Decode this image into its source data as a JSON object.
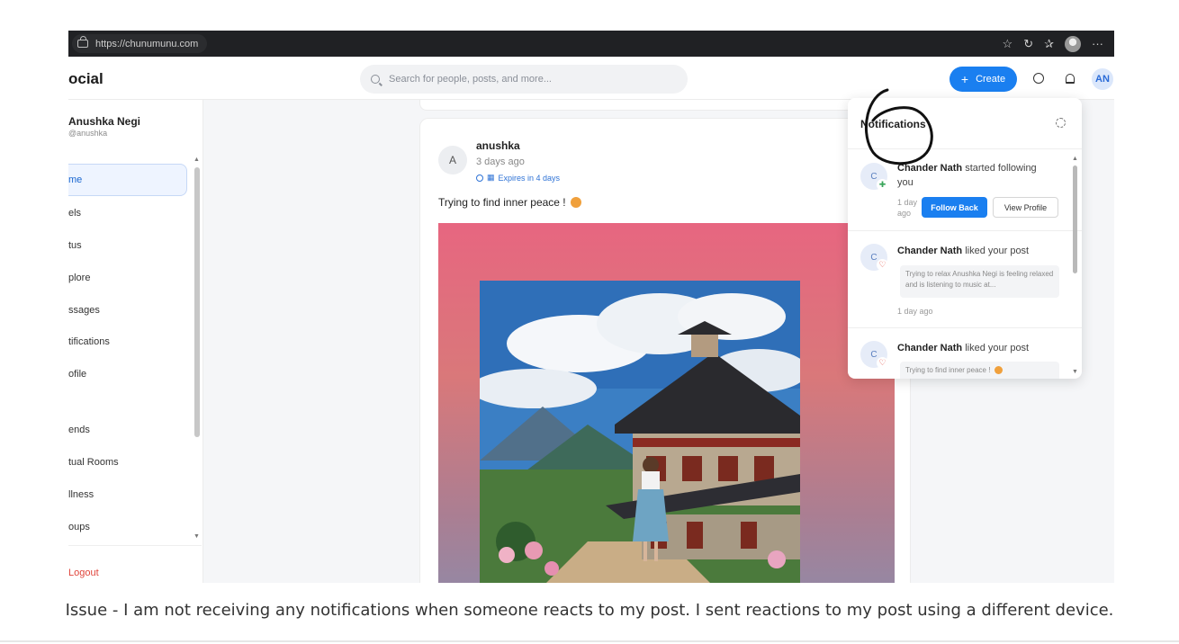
{
  "browser": {
    "url": "https://chunumunu.com",
    "icons": [
      "lock-icon",
      "star-icon",
      "refresh-icon",
      "favorites-icon",
      "profile-icon",
      "more-icon"
    ]
  },
  "app": {
    "brand": "ocial",
    "search_placeholder": "Search for people, posts, and more...",
    "create_label": "Create",
    "avatar_initials": "AN"
  },
  "sidebar": {
    "user_name": "Anushka Negi",
    "user_handle": "@anushka",
    "items": [
      {
        "label": "me",
        "active": true
      },
      {
        "label": "els"
      },
      {
        "label": "tus"
      },
      {
        "label": "plore"
      },
      {
        "label": "ssages"
      },
      {
        "label": "tifications"
      },
      {
        "label": "ofile"
      },
      {
        "label": "ends"
      },
      {
        "label": "tual Rooms"
      },
      {
        "label": "llness"
      },
      {
        "label": "oups"
      }
    ],
    "logout": "Logout"
  },
  "post": {
    "avatar_initial": "A",
    "author": "anushka",
    "time": "3 days ago",
    "expiry": "Expires in 4 days",
    "text": "Trying to find inner peace !"
  },
  "notifications": {
    "title": "Notifications",
    "items": [
      {
        "avatar": "C",
        "name": "Chander Nath",
        "action": "started following you",
        "when": "1 day ago",
        "follow_back": "Follow Back",
        "view_profile": "View Profile"
      },
      {
        "avatar": "C",
        "name": "Chander Nath",
        "action": "liked your post",
        "preview": "Trying to relax Anushka Negi is feeling relaxed and is listening to music at...",
        "when": "1 day ago"
      },
      {
        "avatar": "C",
        "name": "Chander Nath",
        "action": "liked your post",
        "preview": "Trying to find inner peace !"
      }
    ]
  },
  "caption": "Issue - I am not receiving any notifications when someone reacts to my post. I sent reactions to my post using a different device.",
  "colors": {
    "accent": "#1a7ff0",
    "logout": "#e0453b",
    "browser_bar": "#202124"
  }
}
